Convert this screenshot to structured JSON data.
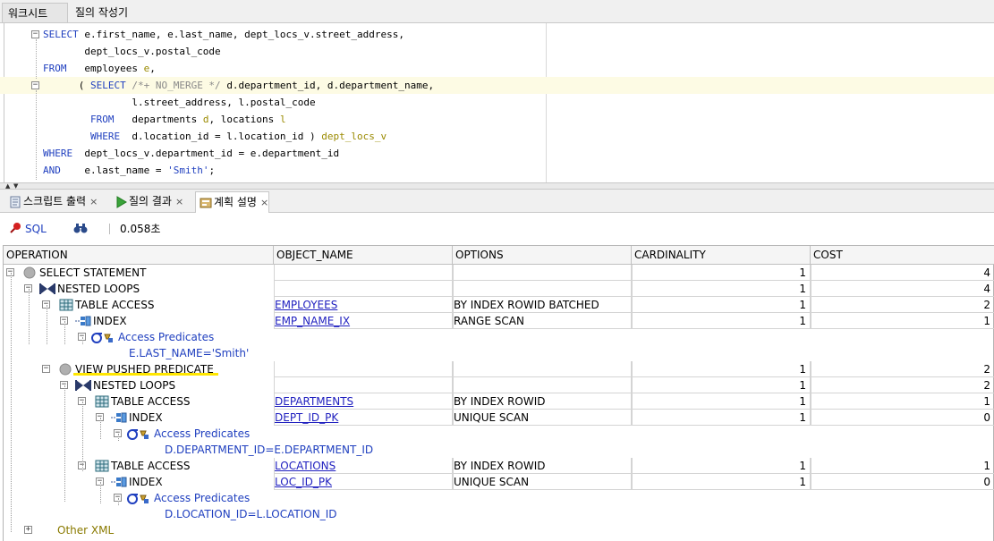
{
  "top_tabs": {
    "worksheet": "워크시트",
    "query_builder": "질의 작성기"
  },
  "editor": {
    "lines": [
      {
        "parts": [
          [
            "kw",
            "SELECT "
          ],
          [
            "txt",
            "e.first_name, e.last_name, dept_locs_v.street_address,"
          ]
        ]
      },
      {
        "parts": [
          [
            "txt",
            "       dept_locs_v.postal_code"
          ]
        ]
      },
      {
        "parts": [
          [
            "kw",
            "FROM   "
          ],
          [
            "txt",
            "employees "
          ],
          [
            "al",
            "e"
          ],
          [
            "txt",
            ","
          ]
        ]
      },
      {
        "parts": [
          [
            "txt",
            "      ( "
          ],
          [
            "kw",
            "SELECT "
          ],
          [
            "cm",
            "/*+ NO_MERGE */ "
          ],
          [
            "txt",
            "d.department_id, d.department_name,"
          ]
        ]
      },
      {
        "parts": [
          [
            "txt",
            "               l.street_address, l.postal_code"
          ]
        ]
      },
      {
        "parts": [
          [
            "kw",
            "        FROM   "
          ],
          [
            "txt",
            "departments "
          ],
          [
            "al",
            "d"
          ],
          [
            "txt",
            ", locations "
          ],
          [
            "al",
            "l"
          ]
        ]
      },
      {
        "parts": [
          [
            "kw",
            "        WHERE  "
          ],
          [
            "txt",
            "d.location_id = l.location_id ) "
          ],
          [
            "al",
            "dept_locs_v"
          ]
        ]
      },
      {
        "parts": [
          [
            "kw",
            "WHERE  "
          ],
          [
            "txt",
            "dept_locs_v.department_id = e.department_id"
          ]
        ]
      },
      {
        "parts": [
          [
            "kw",
            "AND    "
          ],
          [
            "txt",
            "e.last_name = "
          ],
          [
            "str",
            "'Smith'"
          ],
          [
            "txt",
            ";"
          ]
        ]
      }
    ]
  },
  "bottom_tabs": {
    "script_output": "스크립트 출력",
    "query_result": "질의 결과",
    "explain_plan": "계획 설명"
  },
  "toolbar": {
    "sql_label": "SQL",
    "elapsed": "0.058초"
  },
  "grid": {
    "headers": [
      "OPERATION",
      "OBJECT_NAME",
      "OPTIONS",
      "CARDINALITY",
      "COST"
    ],
    "rows": [
      {
        "op": "SELECT STATEMENT",
        "obj": "",
        "opt": "",
        "card": "1",
        "cost": "4"
      },
      {
        "op": "NESTED LOOPS",
        "obj": "",
        "opt": "",
        "card": "1",
        "cost": "4"
      },
      {
        "op": "TABLE ACCESS",
        "obj": "EMPLOYEES",
        "opt": "BY INDEX ROWID BATCHED",
        "card": "1",
        "cost": "2"
      },
      {
        "op": "INDEX",
        "obj": "EMP_NAME_IX",
        "opt": "RANGE SCAN",
        "card": "1",
        "cost": "1"
      },
      {
        "op": "Access Predicates",
        "obj": "",
        "opt": "",
        "card": "",
        "cost": ""
      },
      {
        "op": "E.LAST_NAME='Smith'",
        "obj": "",
        "opt": "",
        "card": "",
        "cost": ""
      },
      {
        "op": "VIEW PUSHED PREDICATE",
        "obj": "",
        "opt": "",
        "card": "1",
        "cost": "2"
      },
      {
        "op": "NESTED LOOPS",
        "obj": "",
        "opt": "",
        "card": "1",
        "cost": "2"
      },
      {
        "op": "TABLE ACCESS",
        "obj": "DEPARTMENTS",
        "opt": "BY INDEX ROWID",
        "card": "1",
        "cost": "1"
      },
      {
        "op": "INDEX",
        "obj": "DEPT_ID_PK",
        "opt": "UNIQUE SCAN",
        "card": "1",
        "cost": "0"
      },
      {
        "op": "Access Predicates",
        "obj": "",
        "opt": "",
        "card": "",
        "cost": ""
      },
      {
        "op": "D.DEPARTMENT_ID=E.DEPARTMENT_ID",
        "obj": "",
        "opt": "",
        "card": "",
        "cost": ""
      },
      {
        "op": "TABLE ACCESS",
        "obj": "LOCATIONS",
        "opt": "BY INDEX ROWID",
        "card": "1",
        "cost": "1"
      },
      {
        "op": "INDEX",
        "obj": "LOC_ID_PK",
        "opt": "UNIQUE SCAN",
        "card": "1",
        "cost": "0"
      },
      {
        "op": "Access Predicates",
        "obj": "",
        "opt": "",
        "card": "",
        "cost": ""
      },
      {
        "op": "D.LOCATION_ID=L.LOCATION_ID",
        "obj": "",
        "opt": "",
        "card": "",
        "cost": ""
      },
      {
        "op": "Other XML",
        "obj": "",
        "opt": "",
        "card": "",
        "cost": ""
      }
    ]
  }
}
